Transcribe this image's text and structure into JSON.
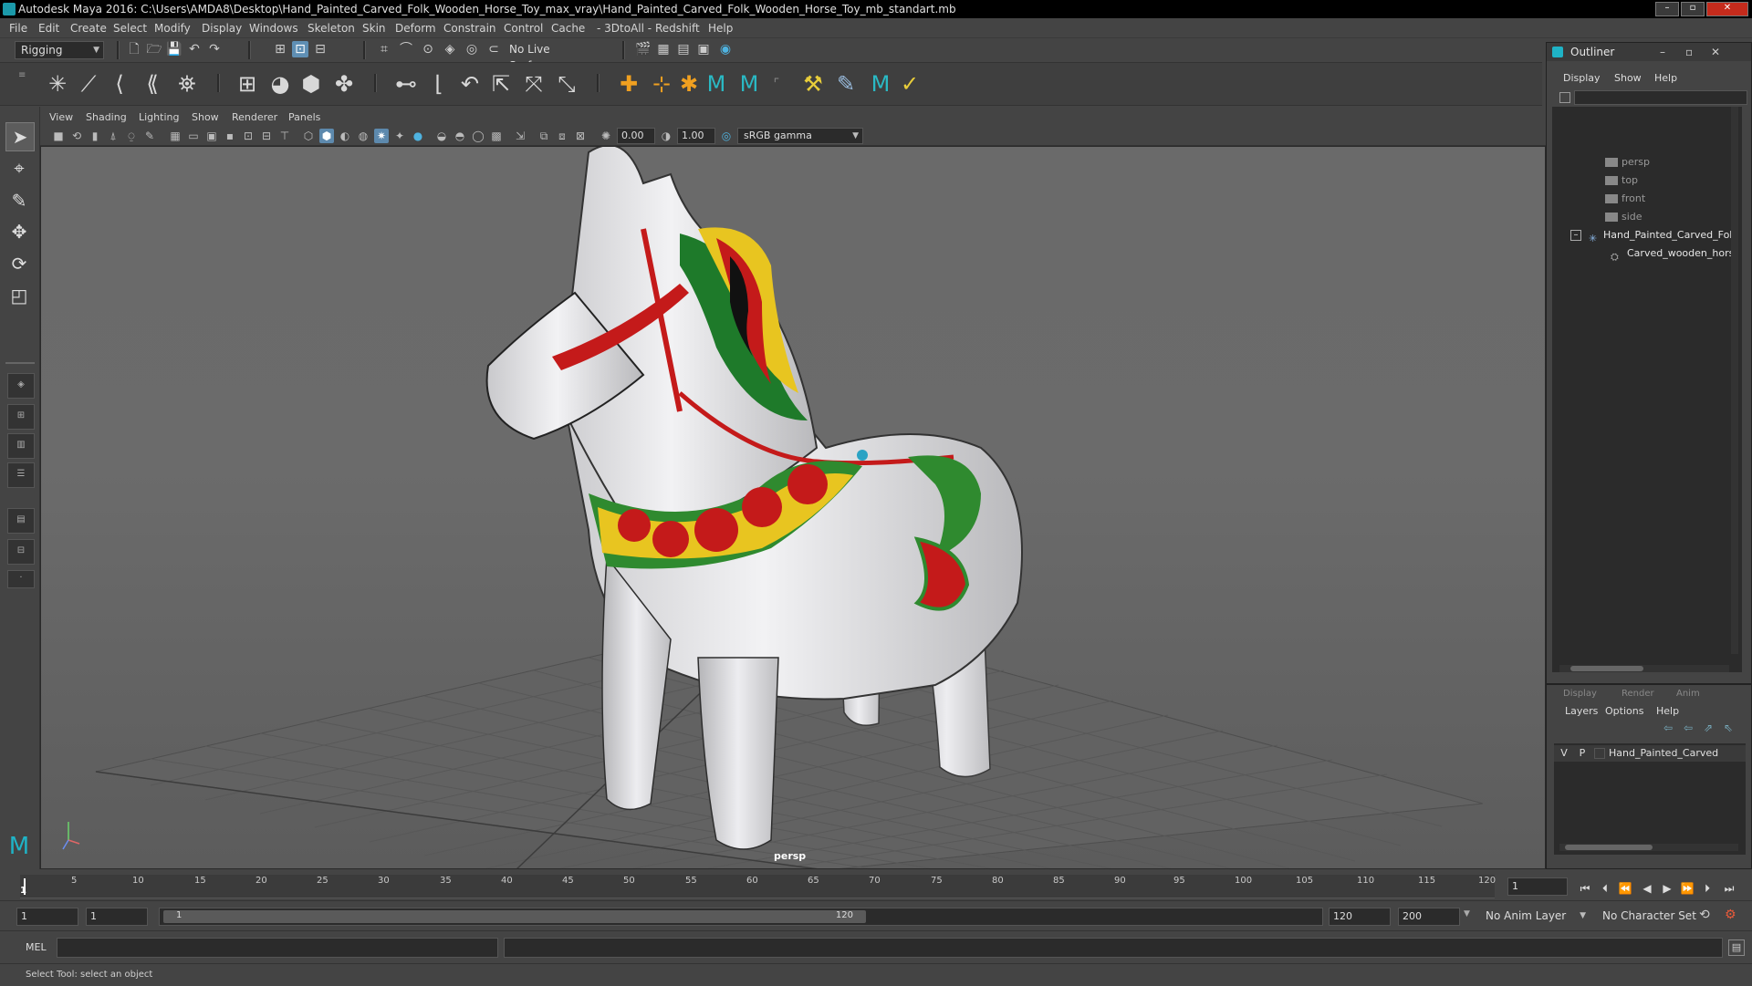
{
  "window": {
    "title": "Autodesk Maya 2016: C:\\Users\\AMDA8\\Desktop\\Hand_Painted_Carved_Folk_Wooden_Horse_Toy_max_vray\\Hand_Painted_Carved_Folk_Wooden_Horse_Toy_mb_standart.mb",
    "minimize": "–",
    "restore": "▫",
    "close": "✕"
  },
  "menubar": [
    "File",
    "Edit",
    "Create",
    "Select",
    "Modify",
    "Display",
    "Windows",
    "Skeleton",
    "Skin",
    "Deform",
    "Constrain",
    "Control",
    "Cache",
    "- 3DtoAll -",
    "Redshift",
    "Help"
  ],
  "statusline": {
    "menuset": "Rigging",
    "live_surface": "No Live Surface"
  },
  "viewport": {
    "menu": [
      "View",
      "Shading",
      "Lighting",
      "Show",
      "Renderer",
      "Panels"
    ],
    "exposure": "0.00",
    "gamma": "1.00",
    "colorspace": "sRGB gamma",
    "camera_label": "persp"
  },
  "outliner": {
    "title": "Outliner",
    "menu": [
      "Display",
      "Show",
      "Help"
    ],
    "items": [
      "persp",
      "top",
      "front",
      "side",
      "Hand_Painted_Carved_Fol",
      "Carved_wooden_hors"
    ]
  },
  "layers": {
    "tabs": [
      "Display",
      "Render",
      "Anim"
    ],
    "menu": [
      "Layers",
      "Options",
      "Help"
    ],
    "row": {
      "v": "V",
      "p": "P",
      "name": "Hand_Painted_Carved"
    }
  },
  "timeline": {
    "ticks": [
      "5",
      "10",
      "15",
      "20",
      "25",
      "30",
      "35",
      "40",
      "45",
      "50",
      "55",
      "60",
      "65",
      "70",
      "75",
      "80",
      "85",
      "90",
      "95",
      "100",
      "105",
      "110",
      "115",
      "120"
    ],
    "current_marker": "1",
    "current_frame": "1"
  },
  "range": {
    "start": "1",
    "playback_start": "1",
    "slider_start": "1",
    "slider_end": "120",
    "playback_end": "120",
    "end": "200",
    "anim_layer": "No Anim Layer",
    "character_set": "No Character Set"
  },
  "cmdline": {
    "lang": "MEL"
  },
  "helpline": {
    "text": "Select Tool: select an object"
  },
  "colors": {
    "accent": "#5f8fb4",
    "maya_teal": "#1b9aaa",
    "viewport_bg": "#6a6a6a"
  }
}
